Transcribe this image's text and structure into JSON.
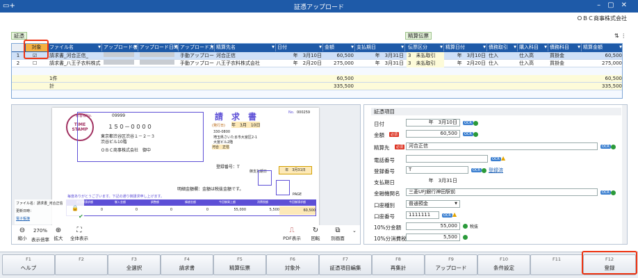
{
  "window": {
    "title": "証憑アップロード",
    "company": "ＯＢＣ商事株式会社"
  },
  "section_left": "証憑",
  "section_right": "精算伝票",
  "grid": {
    "headers": [
      "対象",
      "ファイル名",
      "アップロード者名",
      "アップロード日時",
      "アップロード方法",
      "精算先名",
      "日付",
      "金額",
      "支払期日",
      "伝票区分",
      "精算日付",
      "債務取引",
      "購入科目",
      "債務科目",
      "精算金額"
    ],
    "rows": [
      {
        "no": "1",
        "file": "請求書_河合正信_",
        "method": "手動アップロード",
        "payee": "河合正信",
        "date": "年　3月10日",
        "amount": "60,500",
        "due": "年　3月31日",
        "kubun": "3　未払取引",
        "sdate": "年　3月10日",
        "torihiki": "仕入",
        "kamoku": "仕入高",
        "saimu": "買掛金",
        "samount": "60,500"
      },
      {
        "no": "2",
        "file": "請求書_八王子衣料株式",
        "method": "手動アップロード",
        "payee": "八王子衣料株式会社",
        "date": "年　2月20日",
        "amount": "275,000",
        "due": "年　3月31日",
        "kubun": "3　未払取引",
        "sdate": "年　2月20日",
        "torihiki": "仕入",
        "kamoku": "仕入高",
        "saimu": "買掛金",
        "samount": "275,000"
      }
    ],
    "sum1_label": "1件",
    "sum1_amount": "60,500",
    "sum1_samount": "60,500",
    "sum2_label": "計",
    "sum2_amount": "335,500",
    "sum2_samount": "335,500"
  },
  "doc": {
    "title": "請　求　書",
    "client_no_label": "お客様No.",
    "client_no": "09999",
    "stamp1": "TIME",
    "stamp2": "STAMP",
    "zip": "１５０－００００",
    "addr1": "東京都渋谷区渋谷１－２－３",
    "addr2": "渋谷ビル10階",
    "client": "ＯＢＣ商事株式会社　御中",
    "issue": "(発行日)",
    "issue_date": "年　3月　10日",
    "no_label": "No.",
    "no": "000259",
    "s_zip": "330-0800",
    "s_addr": "埼玉県さいたま市大宮区2-1",
    "s_bldg": "大宮ビル2階",
    "s_name": "河合　正信",
    "reg": "登録番号：T",
    "due_label": "御支払期日",
    "due": "年　3月31日",
    "note": "明細金額欄：金額は税抜金額です。",
    "page": "PAGE",
    "thanks": "毎度ありがとうございます。下記の通り御請求申し上げます。",
    "tbl_headers": [
      "前回御請求額",
      "御入金額",
      "調整額",
      "繰越金額",
      "今回御買上額",
      "消費税額",
      "今回御請求額"
    ],
    "tbl_values": [
      "0",
      "0",
      "0",
      "0",
      "55,000",
      "5,500",
      "60,500"
    ],
    "file_label": "ファイル名：請求書_河合正信",
    "upd_label": "更新日時：",
    "detail_link": "電子帳簿"
  },
  "toolbar": {
    "zoom_out": "縮小",
    "zoom_value": "270%",
    "zoom_value_label": "表示倍率",
    "zoom_in": "拡大",
    "fit": "全体表示",
    "pdf": "PDF表示",
    "rotate": "回転",
    "separate": "別画面"
  },
  "props": {
    "title": "証憑項目",
    "date_label": "日付",
    "date_value": "年　3月10日",
    "amount_label": "金額",
    "amount_value": "60,500",
    "payee_label": "精算先",
    "payee_value": "河合正信",
    "phone_label": "電話番号",
    "phone_value": "",
    "regno_label": "登録番号",
    "regno_value": "T",
    "regno_link": "登録済",
    "due_label": "支払期日",
    "due_value": "年　3月31日",
    "bank_label": "金融機関名",
    "bank_value": "三菱UFJ銀行神田駅前",
    "acct_type_label": "口座種別",
    "acct_type_value": "普通預金",
    "acct_no_label": "口座番号",
    "acct_no_value": "1111111",
    "tax10_label": "10%分金額",
    "tax10_value": "55,000",
    "tax10_note": "税抜",
    "tax10c_label": "10%分消費税",
    "tax10c_value": "5,500",
    "req": "必須",
    "ocr": "OCR"
  },
  "fkeys": [
    {
      "key": "F1",
      "label": "ヘルプ"
    },
    {
      "key": "F2",
      "label": ""
    },
    {
      "key": "F3",
      "label": "全選択"
    },
    {
      "key": "F4",
      "label": "請求書"
    },
    {
      "key": "F5",
      "label": "精算伝票"
    },
    {
      "key": "F6",
      "label": "対象外"
    },
    {
      "key": "F7",
      "label": "証憑項目編集"
    },
    {
      "key": "F8",
      "label": "再集計"
    },
    {
      "key": "F9",
      "label": "アップロード"
    },
    {
      "key": "F10",
      "label": "条件設定"
    },
    {
      "key": "F11",
      "label": ""
    },
    {
      "key": "F12",
      "label": "登録"
    }
  ],
  "colors": {
    "titlebar": "#1e5aa8",
    "highlight": "#e31",
    "sum_row": "#fdfbd9"
  }
}
